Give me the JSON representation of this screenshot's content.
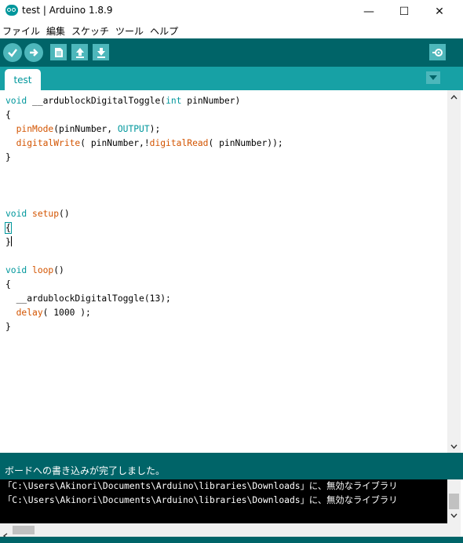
{
  "window": {
    "title": "test | Arduino 1.8.9",
    "minimize": "—",
    "maximize": "☐",
    "close": "✕"
  },
  "menu": [
    "ファイル",
    "編集",
    "スケッチ",
    "ツール",
    "ヘルプ"
  ],
  "toolbar": {
    "icons": [
      "verify-icon",
      "upload-icon",
      "new-sketch-icon",
      "open-icon",
      "save-icon",
      "serial-monitor-icon"
    ],
    "accent": "#006468",
    "button_color": "#4db7bb"
  },
  "tab": {
    "label": "test"
  },
  "code": {
    "line1": {
      "kw": "void",
      "t1": " __ardublockDigitalToggle(",
      "kw2": "int",
      "t2": " pinNumber)"
    },
    "line2": "{",
    "line3": {
      "fn": "pinMode",
      "t1": "(pinNumber, ",
      "kw": "OUTPUT",
      "t2": ");"
    },
    "line4": {
      "fn": "digitalWrite",
      "t1": "( pinNumber,!",
      "fn2": "digitalRead",
      "t2": "( pinNumber));"
    },
    "line5": "}",
    "line6": {
      "kw": "void",
      "fn": "setup",
      "t": "()"
    },
    "line7": "{",
    "line8": "}",
    "line9": {
      "kw": "void",
      "fn": "loop",
      "t": "()"
    },
    "line10": "{",
    "line11": "__ardublockDigitalToggle(13);",
    "line12": {
      "fn": "delay",
      "t": "( 1000 );"
    },
    "line13": "}"
  },
  "status": {
    "message": "ボードへの書き込みが完了しました。"
  },
  "console": {
    "lines": [
      "「C:\\Users\\Akinori\\Documents\\Arduino\\libraries\\Downloads」に、無効なライブラリ",
      "「C:\\Users\\Akinori\\Documents\\Arduino\\libraries\\Downloads」に、無効なライブラリ"
    ]
  }
}
